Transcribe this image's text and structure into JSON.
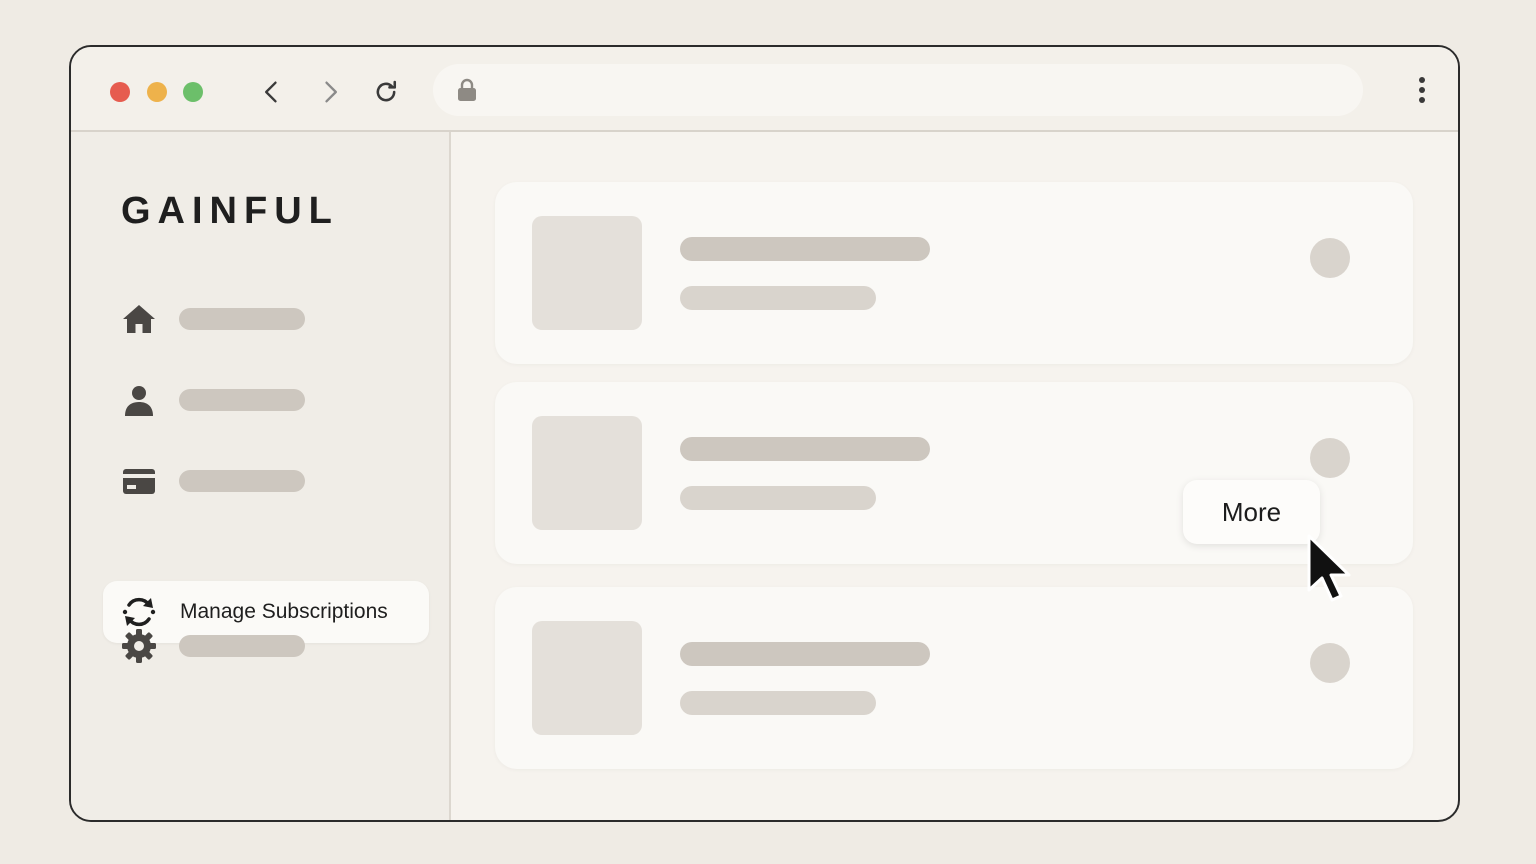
{
  "app": {
    "logo": "GAINFUL"
  },
  "browser": {
    "buttons": [
      "back-icon",
      "forward-icon",
      "reload-icon",
      "more-vertical-icon"
    ],
    "address_icon": "lock-icon",
    "traffic_lights": {
      "close": "#e65c4f",
      "minimize": "#eeb24b",
      "maximize": "#6cbf6a"
    }
  },
  "sidebar": {
    "items": [
      {
        "icon": "home-icon",
        "label": ""
      },
      {
        "icon": "user-icon",
        "label": ""
      },
      {
        "icon": "credit-card-icon",
        "label": ""
      },
      {
        "icon": "refresh-cycle-icon",
        "label": "Manage Subscriptions",
        "active": true
      },
      {
        "icon": "gear-icon",
        "label": ""
      }
    ]
  },
  "main": {
    "cards": [
      {
        "title": "",
        "subtitle": ""
      },
      {
        "title": "",
        "subtitle": ""
      },
      {
        "title": "",
        "subtitle": ""
      }
    ],
    "popover": {
      "label": "More"
    }
  }
}
